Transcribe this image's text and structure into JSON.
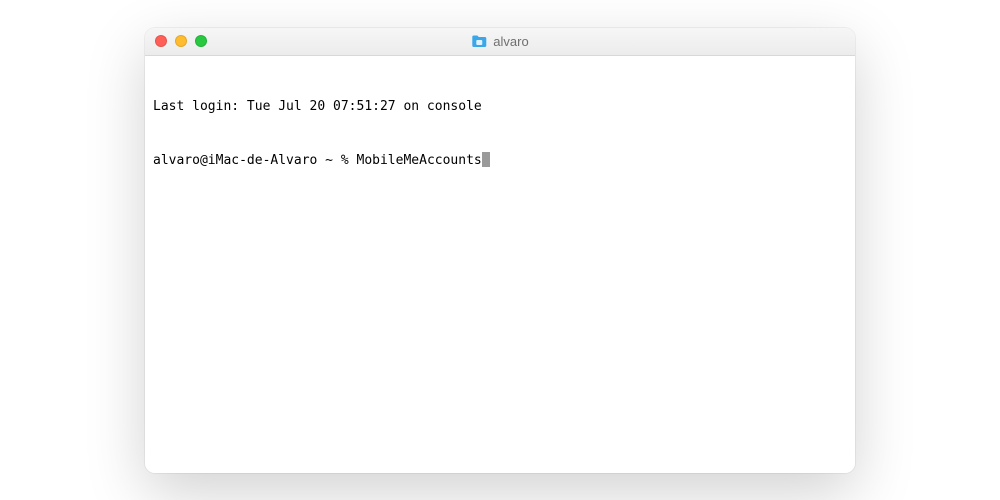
{
  "window": {
    "title": "alvaro"
  },
  "terminal": {
    "last_login": "Last login: Tue Jul 20 07:51:27 on console",
    "prompt": "alvaro@iMac-de-Alvaro ~ % ",
    "command": "MobileMeAccounts"
  }
}
